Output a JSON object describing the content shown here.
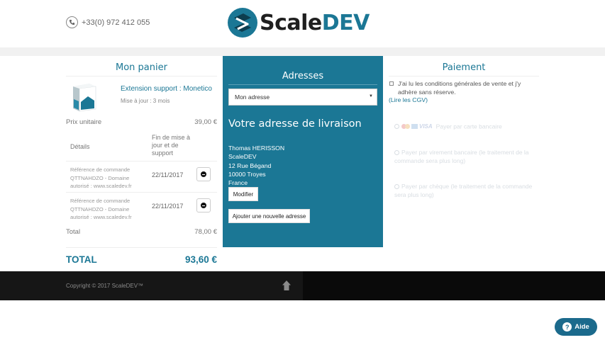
{
  "header": {
    "phone": "+33(0) 972 412 055",
    "logo_part1": "Scale",
    "logo_part2": "DEV"
  },
  "cart": {
    "title": "Mon panier",
    "product_name": "Extension support : Monetico",
    "product_update": "Mise à jour : 3 mois",
    "unit_price_label": "Prix unitaire",
    "unit_price_value": "39,00 €",
    "details_label": "Détails",
    "end_label": "Fin de mise à jour et de support",
    "rows": [
      {
        "ref": "Référence de commande QTTNAHDZO - Domaine autorisé : www.scaledev.fr",
        "date": "22/11/2017"
      },
      {
        "ref": "Référence de commande QTTNAHDZO - Domaine autorisé : www.scaledev.fr",
        "date": "22/11/2017"
      }
    ],
    "total_label": "Total",
    "total_value": "78,00 €",
    "grand_total_label": "TOTAL",
    "grand_total_value": "93,60 €"
  },
  "addresses": {
    "title": "Adresses",
    "select_value": "Mon adresse",
    "delivery_title": "Votre adresse de livraison",
    "lines": [
      "Thomas HERISSON",
      "ScaleDEV",
      "12 Rue Bégand",
      "10000 Troyes",
      "France"
    ],
    "modify_label": "Modifier",
    "add_label": "Ajouter une nouvelle adresse"
  },
  "payment": {
    "title": "Paiement",
    "cgv_text": "J'ai lu les conditions générales de vente et j'y adhère sans réserve.",
    "cgv_link": "(Lire les CGV)",
    "options": [
      "Payer par carte bancaire",
      "Payer par virement bancaire (le traitement de la commande sera plus long)",
      "Payer par chèque (le traitement de la commande sera plus long)"
    ],
    "visa_text": "VISA"
  },
  "footer": {
    "copyright": "Copyright © 2017 ScaleDEV™"
  },
  "help": {
    "label": "Aide",
    "icon_text": "?"
  },
  "colors": {
    "accent": "#1b7795",
    "footer": "#0a0a0a"
  }
}
